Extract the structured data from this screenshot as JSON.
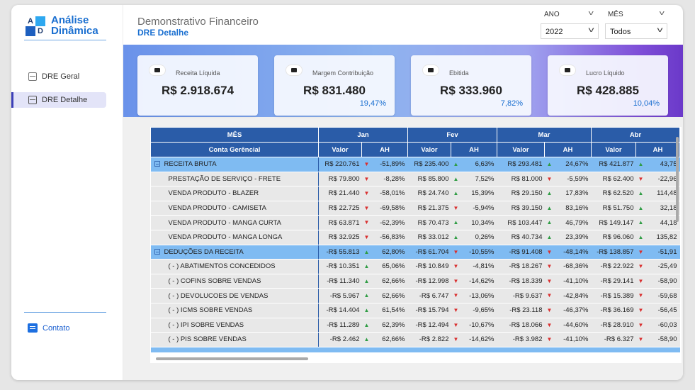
{
  "logo": {
    "l1": "A",
    "l2": "D",
    "line1": "Análise",
    "line2": "Dinâmica"
  },
  "sidebar": {
    "items": [
      {
        "label": "DRE Geral",
        "icon": "table-icon"
      },
      {
        "label": "DRE Detalhe",
        "icon": "list-icon"
      }
    ],
    "contact": {
      "label": "Contato",
      "icon": "chat-icon"
    }
  },
  "header": {
    "title": "Demonstrativo Financeiro",
    "subtitle": "DRE Detalhe"
  },
  "filters": {
    "ano": {
      "label": "ANO",
      "value": "2022"
    },
    "mes": {
      "label": "MÊS",
      "value": "Todos"
    }
  },
  "kpis": [
    {
      "label": "Receita Líquida",
      "value": "R$ 2.918.674",
      "pct": ""
    },
    {
      "label": "Margem Contribuição",
      "value": "R$ 831.480",
      "pct": "19,47%"
    },
    {
      "label": "Ebitida",
      "value": "R$ 333.960",
      "pct": "7,82%"
    },
    {
      "label": "Lucro Líquido",
      "value": "R$ 428.885",
      "pct": "10,04%"
    }
  ],
  "table": {
    "mes_header": "MÊS",
    "account_header": "Conta Gerêncial",
    "months": [
      "Jan",
      "Fev",
      "Mar",
      "Abr"
    ],
    "col_valor": "Valor",
    "col_ah": "AH",
    "rows": [
      {
        "type": "cat",
        "name": "RECEITA BRUTA",
        "cells": [
          [
            "R$ 220.761",
            "down",
            "-51,89%"
          ],
          [
            "R$ 235.400",
            "up",
            "6,63%"
          ],
          [
            "R$ 293.481",
            "up",
            "24,67%"
          ],
          [
            "R$ 421.877",
            "up",
            "43,75"
          ]
        ]
      },
      {
        "type": "row",
        "name": "PRESTAÇÃO DE SERVIÇO - FRETE",
        "cells": [
          [
            "R$ 79.800",
            "down",
            "-8,28%"
          ],
          [
            "R$ 85.800",
            "up",
            "7,52%"
          ],
          [
            "R$ 81.000",
            "down",
            "-5,59%"
          ],
          [
            "R$ 62.400",
            "down",
            "-22,96"
          ]
        ]
      },
      {
        "type": "row",
        "name": "VENDA PRODUTO - BLAZER",
        "cells": [
          [
            "R$ 21.440",
            "down",
            "-58,01%"
          ],
          [
            "R$ 24.740",
            "up",
            "15,39%"
          ],
          [
            "R$ 29.150",
            "up",
            "17,83%"
          ],
          [
            "R$ 62.520",
            "up",
            "114,48"
          ]
        ]
      },
      {
        "type": "row",
        "name": "VENDA PRODUTO - CAMISETA",
        "cells": [
          [
            "R$ 22.725",
            "down",
            "-69,58%"
          ],
          [
            "R$ 21.375",
            "down",
            "-5,94%"
          ],
          [
            "R$ 39.150",
            "up",
            "83,16%"
          ],
          [
            "R$ 51.750",
            "up",
            "32,18"
          ]
        ]
      },
      {
        "type": "row",
        "name": "VENDA PRODUTO - MANGA CURTA",
        "cells": [
          [
            "R$ 63.871",
            "down",
            "-62,39%"
          ],
          [
            "R$ 70.473",
            "up",
            "10,34%"
          ],
          [
            "R$ 103.447",
            "up",
            "46,79%"
          ],
          [
            "R$ 149.147",
            "up",
            "44,18"
          ]
        ]
      },
      {
        "type": "row",
        "name": "VENDA PRODUTO - MANGA LONGA",
        "cells": [
          [
            "R$ 32.925",
            "down",
            "-56,83%"
          ],
          [
            "R$ 33.012",
            "up",
            "0,26%"
          ],
          [
            "R$ 40.734",
            "up",
            "23,39%"
          ],
          [
            "R$ 96.060",
            "up",
            "135,82"
          ]
        ]
      },
      {
        "type": "cat",
        "name": "DEDUÇÕES DA RECEITA",
        "cells": [
          [
            "-R$ 55.813",
            "up",
            "62,80%"
          ],
          [
            "-R$ 61.704",
            "down",
            "-10,55%"
          ],
          [
            "-R$ 91.408",
            "down",
            "-48,14%"
          ],
          [
            "-R$ 138.857",
            "down",
            "-51,91"
          ]
        ]
      },
      {
        "type": "row",
        "name": "( - ) ABATIMENTOS CONCEDIDOS",
        "cells": [
          [
            "-R$ 10.351",
            "up",
            "65,06%"
          ],
          [
            "-R$ 10.849",
            "down",
            "-4,81%"
          ],
          [
            "-R$ 18.267",
            "down",
            "-68,36%"
          ],
          [
            "-R$ 22.922",
            "down",
            "-25,49"
          ]
        ]
      },
      {
        "type": "row",
        "name": "( - ) COFINS SOBRE VENDAS",
        "cells": [
          [
            "-R$ 11.340",
            "up",
            "62,66%"
          ],
          [
            "-R$ 12.998",
            "down",
            "-14,62%"
          ],
          [
            "-R$ 18.339",
            "down",
            "-41,10%"
          ],
          [
            "-R$ 29.141",
            "down",
            "-58,90"
          ]
        ]
      },
      {
        "type": "row",
        "name": "( - ) DEVOLUCOES DE VENDAS",
        "cells": [
          [
            "-R$ 5.967",
            "up",
            "62,66%"
          ],
          [
            "-R$ 6.747",
            "down",
            "-13,06%"
          ],
          [
            "-R$ 9.637",
            "down",
            "-42,84%"
          ],
          [
            "-R$ 15.389",
            "down",
            "-59,68"
          ]
        ]
      },
      {
        "type": "row",
        "name": "( - ) ICMS SOBRE VENDAS",
        "cells": [
          [
            "-R$ 14.404",
            "up",
            "61,54%"
          ],
          [
            "-R$ 15.794",
            "down",
            "-9,65%"
          ],
          [
            "-R$ 23.118",
            "down",
            "-46,37%"
          ],
          [
            "-R$ 36.169",
            "down",
            "-56,45"
          ]
        ]
      },
      {
        "type": "row",
        "name": "( - ) IPI SOBRE VENDAS",
        "cells": [
          [
            "-R$ 11.289",
            "up",
            "62,39%"
          ],
          [
            "-R$ 12.494",
            "down",
            "-10,67%"
          ],
          [
            "-R$ 18.066",
            "down",
            "-44,60%"
          ],
          [
            "-R$ 28.910",
            "down",
            "-60,03"
          ]
        ]
      },
      {
        "type": "row",
        "name": "( - ) PIS SOBRE VENDAS",
        "cells": [
          [
            "-R$ 2.462",
            "up",
            "62,66%"
          ],
          [
            "-R$ 2.822",
            "down",
            "-14,62%"
          ],
          [
            "-R$ 3.982",
            "down",
            "-41,10%"
          ],
          [
            "-R$ 6.327",
            "down",
            "-58,90"
          ]
        ]
      }
    ]
  }
}
